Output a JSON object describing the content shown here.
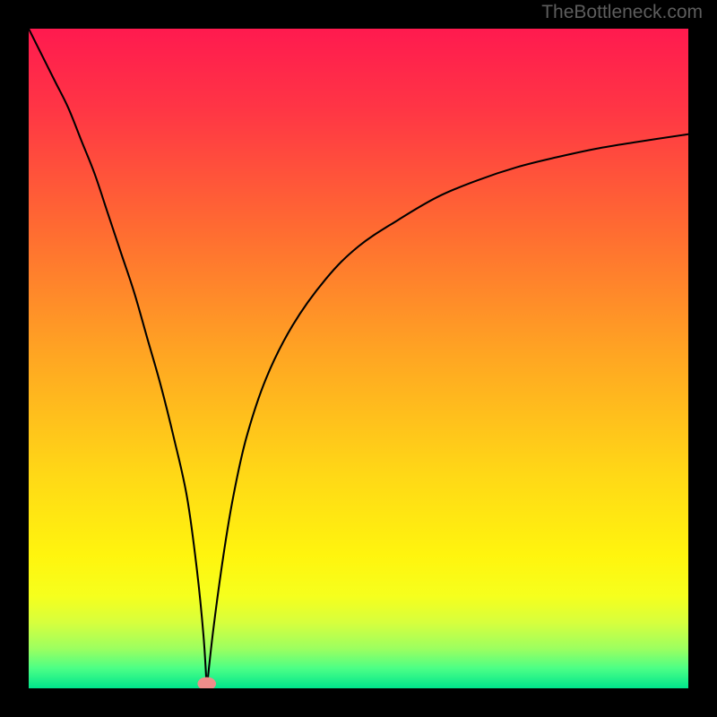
{
  "watermark": "TheBottleneck.com",
  "chart_data": {
    "type": "line",
    "title": "",
    "xlabel": "",
    "ylabel": "",
    "xlim": [
      0,
      100
    ],
    "ylim": [
      0,
      100
    ],
    "background": {
      "type": "vertical-gradient",
      "stops": [
        {
          "pos": 0.0,
          "color": "#ff1a4f"
        },
        {
          "pos": 0.12,
          "color": "#ff3545"
        },
        {
          "pos": 0.3,
          "color": "#ff6a32"
        },
        {
          "pos": 0.5,
          "color": "#ffa722"
        },
        {
          "pos": 0.68,
          "color": "#ffd916"
        },
        {
          "pos": 0.8,
          "color": "#fff50e"
        },
        {
          "pos": 0.86,
          "color": "#f6ff1d"
        },
        {
          "pos": 0.9,
          "color": "#d7ff3d"
        },
        {
          "pos": 0.94,
          "color": "#9cff60"
        },
        {
          "pos": 0.97,
          "color": "#4bff86"
        },
        {
          "pos": 1.0,
          "color": "#00e58c"
        }
      ]
    },
    "series": [
      {
        "name": "left-branch",
        "x": [
          0,
          2,
          4,
          6,
          8,
          10,
          12,
          14,
          16,
          18,
          20,
          22,
          24,
          25.5,
          26.5,
          27.0
        ],
        "y": [
          100,
          96,
          92,
          88,
          83,
          78,
          72,
          66,
          60,
          53,
          46,
          38,
          29,
          18,
          8,
          0
        ]
      },
      {
        "name": "right-branch",
        "x": [
          27.0,
          28.0,
          29.5,
          31,
          33,
          36,
          40,
          45,
          50,
          56,
          62,
          68,
          74,
          80,
          86,
          92,
          100
        ],
        "y": [
          0,
          9,
          20,
          29,
          38,
          47,
          55,
          62,
          67,
          71,
          74.5,
          77,
          79,
          80.5,
          81.8,
          82.8,
          84
        ]
      }
    ],
    "marker": {
      "x": 27.0,
      "y": 0.7,
      "color": "#f08d8a",
      "rx": 1.4,
      "ry": 1.0
    }
  }
}
